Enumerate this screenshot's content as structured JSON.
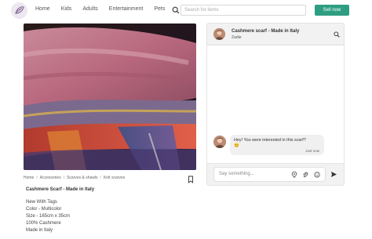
{
  "header": {
    "nav": [
      "Home",
      "Kids",
      "Adults",
      "Entertainment",
      "Pets"
    ],
    "search_placeholder": "Search for items",
    "sell_label": "Sell now"
  },
  "product": {
    "breadcrumb": [
      "Home",
      "Accessories",
      "Scarves & shawls",
      "Knit scarves"
    ],
    "title": "Cashmere Scarf - Made in Italy",
    "details": [
      "New With Tags",
      "Color - Multicolor",
      "Size - 165cm x 35cm",
      "100% Cashmere",
      "Made in Italy"
    ]
  },
  "chat": {
    "title": "Cashmere scarf - Made in Italy",
    "user": "Zadie",
    "message": "Hey! You were interested in this scarf?",
    "emoji": "😊",
    "time": "Just now",
    "input_placeholder": "Say something..."
  },
  "colors": {
    "accent": "#2e9e82"
  }
}
